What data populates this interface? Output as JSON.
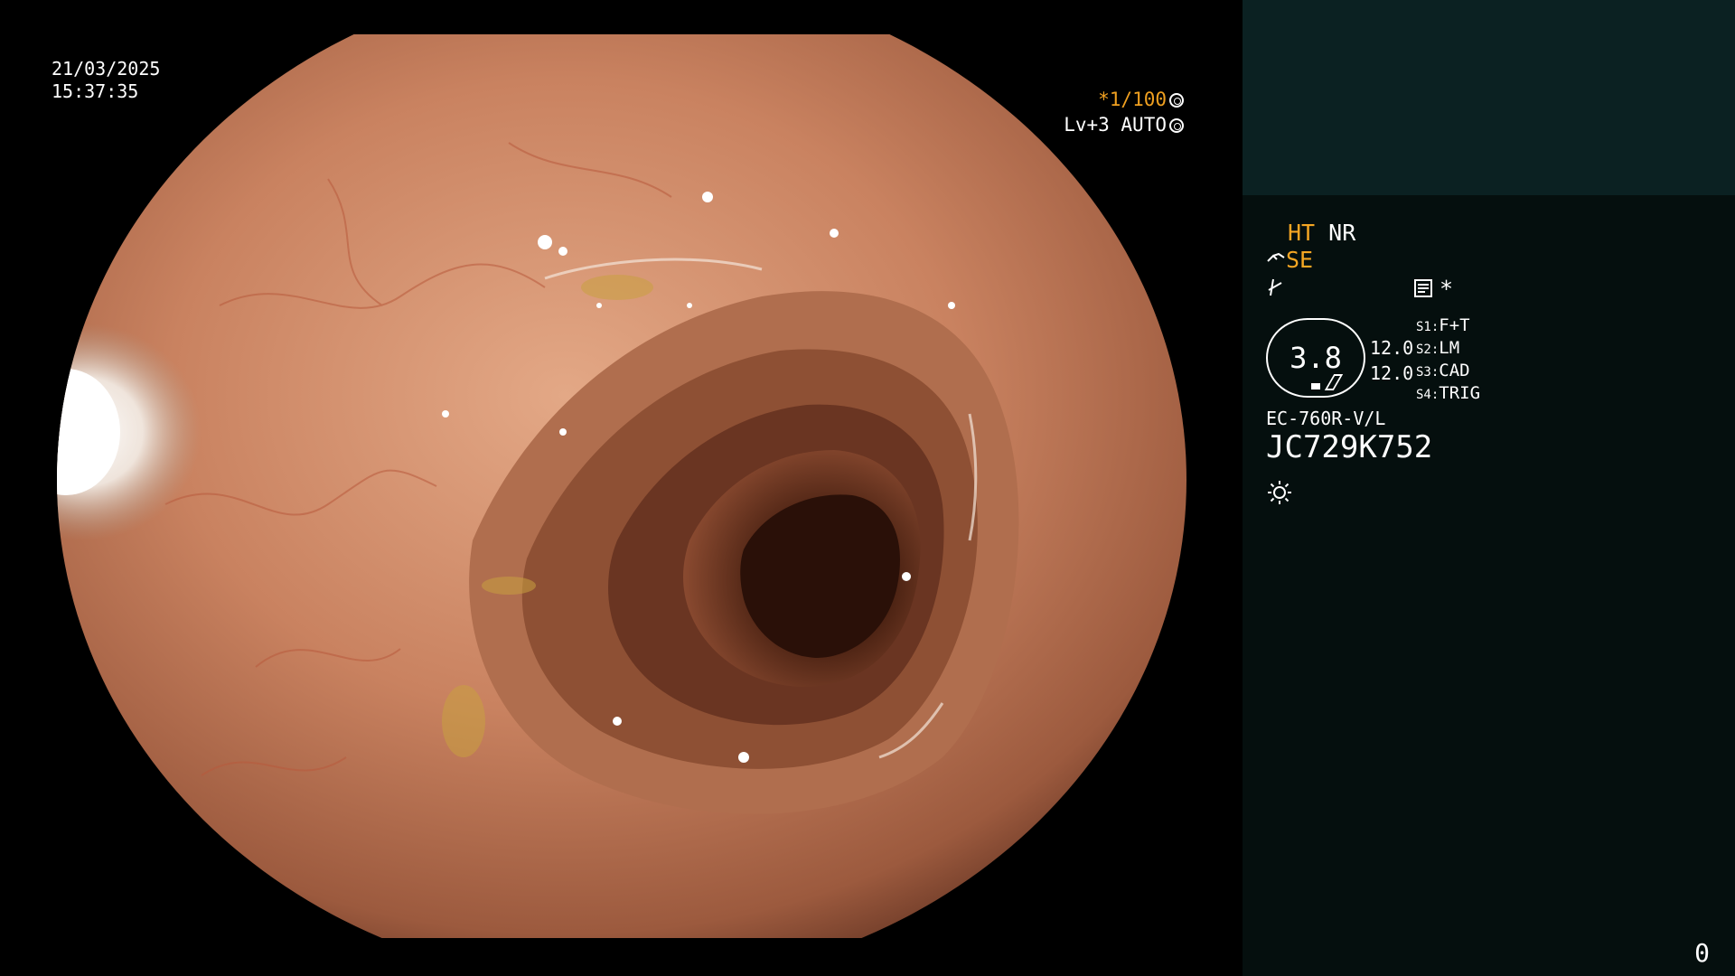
{
  "osd": {
    "date": "21/03/2025",
    "time": "15:37:35",
    "shutter": "*1/100",
    "level": "Lv+3 AUTO"
  },
  "info": {
    "ht": "HT",
    "nr": "NR",
    "se": "SE",
    "asterisk": "*",
    "scope_value": "3.8",
    "value_1": "12.0",
    "value_2": "12.0",
    "switches": [
      {
        "key": "S1:",
        "val": "F+T"
      },
      {
        "key": "S2:",
        "val": "LM"
      },
      {
        "key": "S3:",
        "val": "CAD"
      },
      {
        "key": "S4:",
        "val": "TRIG"
      }
    ],
    "scope_model": "EC-760R-V/L",
    "scope_serial": "JC729K752",
    "frame_count": "0"
  },
  "colors": {
    "panel_top": "#0b2122",
    "panel_bg": "#050f0e",
    "accent_orange": "#f5a623",
    "mucosa": "#c98260",
    "lumen": "#3a1a10"
  },
  "icons": {
    "shutter": "aperture-icon",
    "level": "auto-iris-icon",
    "se": "scope-gesture-icon",
    "zoom": "lightning-icon",
    "memo": "memo-icon",
    "light": "light-source-icon"
  }
}
